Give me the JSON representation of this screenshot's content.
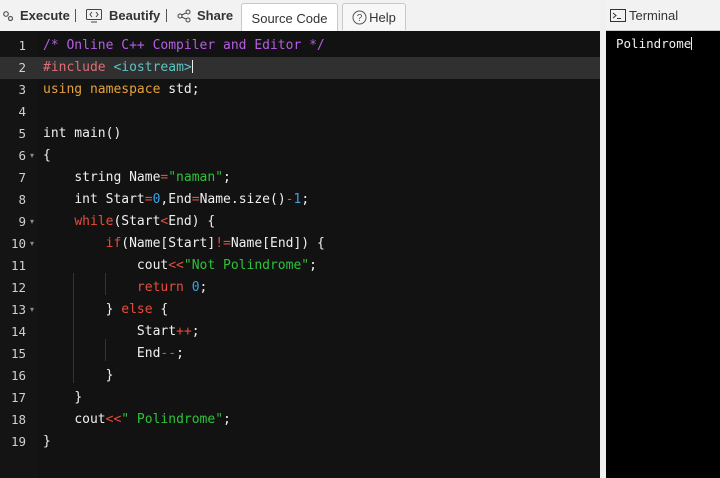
{
  "toolbar": {
    "execute_label": "Execute",
    "beautify_label": "Beautify",
    "share_label": "Share",
    "tabs": [
      {
        "label": "Source Code",
        "active": true
      },
      {
        "label": "Help",
        "active": false
      }
    ]
  },
  "terminal": {
    "title": "Terminal",
    "output": "Polindrome"
  },
  "editor": {
    "current_line": 2,
    "lines": [
      {
        "num": "1",
        "fold": false
      },
      {
        "num": "2",
        "fold": false
      },
      {
        "num": "3",
        "fold": false
      },
      {
        "num": "4",
        "fold": false
      },
      {
        "num": "5",
        "fold": false
      },
      {
        "num": "6",
        "fold": true
      },
      {
        "num": "7",
        "fold": false
      },
      {
        "num": "8",
        "fold": false
      },
      {
        "num": "9",
        "fold": true
      },
      {
        "num": "10",
        "fold": true
      },
      {
        "num": "11",
        "fold": false
      },
      {
        "num": "12",
        "fold": false
      },
      {
        "num": "13",
        "fold": true
      },
      {
        "num": "14",
        "fold": false
      },
      {
        "num": "15",
        "fold": false
      },
      {
        "num": "16",
        "fold": false
      },
      {
        "num": "17",
        "fold": false
      },
      {
        "num": "18",
        "fold": false
      },
      {
        "num": "19",
        "fold": false
      }
    ],
    "tokens": {
      "l1_comment": "/* Online C++ Compiler and Editor */",
      "l2_include": "#include",
      "l2_header": "<iostream>",
      "l3_using": "using namespace",
      "l3_std": " std;",
      "l5_main": "int main()",
      "l6_brace": "{",
      "l7_string_decl": "string Name",
      "l7_eq": "=",
      "l7_literal": "\"naman\"",
      "l7_semi": ";",
      "l8_int": "int Start",
      "l8_eq1": "=",
      "l8_zero": "0",
      "l8_mid": ",End",
      "l8_eq2": "=",
      "l8_size": "Name.size()",
      "l8_minus": "-",
      "l8_one": "1",
      "l8_semi": ";",
      "l9_while": "while",
      "l9_open": "(Start",
      "l9_lt": "<",
      "l9_rest": "End) {",
      "l10_if": "if",
      "l10_open": "(Name[Start]",
      "l10_ne": "!=",
      "l10_rest": "Name[End]) {",
      "l11_cout": "cout",
      "l11_op": "<<",
      "l11_str": "\"Not Polindrome\"",
      "l11_semi": ";",
      "l12_return": "return",
      "l12_zero": " 0",
      "l12_semi": ";",
      "l13_close": "} ",
      "l13_else": "else",
      "l13_open": " {",
      "l14_start": "Start",
      "l14_inc": "++",
      "l14_semi": ";",
      "l15_end": "End",
      "l15_dec": "--",
      "l15_semi": ";",
      "l16_close": "}",
      "l17_close": "}",
      "l18_cout": "cout",
      "l18_op": "<<",
      "l18_str": "\" Polindrome\"",
      "l18_semi": ";",
      "l19_close": "}"
    }
  }
}
